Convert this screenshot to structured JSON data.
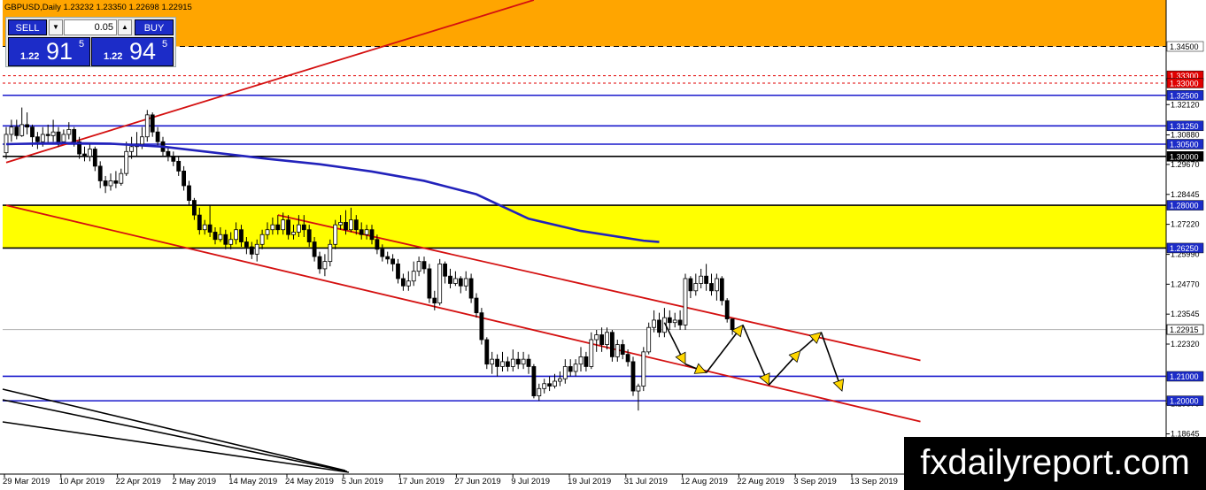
{
  "header": {
    "title": "GBPUSD,Daily  1.23232 1.23350 1.22698 1.22915"
  },
  "trade_panel": {
    "sell_label": "SELL",
    "buy_label": "BUY",
    "lot_value": "0.05",
    "sell_price_prefix": "1.22",
    "sell_price_main": "91",
    "sell_price_sup": "5",
    "buy_price_prefix": "1.22",
    "buy_price_main": "94",
    "buy_price_sup": "5",
    "lot_down_icon": "arrow-down-icon",
    "lot_up_icon": "arrow-up-icon"
  },
  "watermark": "fxdailyreport.com",
  "colors": {
    "orange_zone": "#ffa500",
    "yellow_zone": "#ffff00",
    "blue_line": "#1a1acc",
    "ma_line": "#2222bb",
    "red_line": "#d41010",
    "arrow_fill": "#ffd700",
    "tag_blue": "#1c2cc8",
    "tag_red": "#e00000"
  },
  "chart_data": {
    "type": "candlestick",
    "title": "GBPUSD,Daily",
    "ylim": [
      1.17,
      1.364
    ],
    "grid": false,
    "y_ticks": [
      "1.32120",
      "1.30880",
      "1.29670",
      "1.28445",
      "1.27220",
      "1.25990",
      "1.24770",
      "1.23545",
      "1.22320",
      "1.19870",
      "1.18645"
    ],
    "x_labels": [
      "29 Mar 2019",
      "10 Apr 2019",
      "22 Apr 2019",
      "2 May 2019",
      "14 May 2019",
      "24 May 2019",
      "5 Jun 2019",
      "17 Jun 2019",
      "27 Jun 2019",
      "9 Jul 2019",
      "19 Jul 2019",
      "31 Jul 2019",
      "12 Aug 2019",
      "22 Aug 2019",
      "3 Sep 2019",
      "13 Sep 2019"
    ],
    "horizontal_levels": [
      {
        "price": 1.345,
        "label": "1.34500",
        "color": "#000000",
        "style": "dashed",
        "tag": "white"
      },
      {
        "price": 1.333,
        "label": "1.33300",
        "color": "#e00000",
        "style": "dotted",
        "tag": "red"
      },
      {
        "price": 1.33,
        "label": "1.33000",
        "color": "#e00000",
        "style": "dotted",
        "tag": "red"
      },
      {
        "price": 1.325,
        "label": "1.32500",
        "color": "#1a1acc",
        "style": "solid",
        "tag": "blue"
      },
      {
        "price": 1.3125,
        "label": "1.31250",
        "color": "#1a1acc",
        "style": "solid",
        "tag": "blue"
      },
      {
        "price": 1.305,
        "label": "1.30500",
        "color": "#1a1acc",
        "style": "solid",
        "tag": "blue"
      },
      {
        "price": 1.3,
        "label": "1.30000",
        "color": "#000000",
        "style": "solid",
        "tag": "black"
      },
      {
        "price": 1.28,
        "label": "1.28000",
        "color": "#000000",
        "style": "solid",
        "tag": "blue"
      },
      {
        "price": 1.2625,
        "label": "1.26250",
        "color": "#000000",
        "style": "solid",
        "tag": "blue"
      },
      {
        "price": 1.21,
        "label": "1.21000",
        "color": "#1a1acc",
        "style": "solid",
        "tag": "blue"
      },
      {
        "price": 1.2,
        "label": "1.20000",
        "color": "#1a1acc",
        "style": "solid",
        "tag": "blue"
      }
    ],
    "current_price": {
      "price": 1.22915,
      "label": "1.22915"
    },
    "zones": [
      {
        "from": 1.345,
        "to": 1.364,
        "color": "orange"
      },
      {
        "from": 1.2625,
        "to": 1.28,
        "color": "yellow"
      }
    ],
    "trendlines": [
      {
        "from": [
          0,
          1.2975
        ],
        "to": [
          101,
          1.364
        ],
        "color": "red"
      },
      {
        "from": [
          0,
          1.28
        ],
        "to": [
          175,
          1.1915
        ],
        "color": "red"
      },
      {
        "from": [
          52,
          1.276
        ],
        "to": [
          175,
          1.2165
        ],
        "color": "red"
      }
    ],
    "moving_average": [
      [
        0,
        1.305
      ],
      [
        10,
        1.3055
      ],
      [
        20,
        1.3052
      ],
      [
        30,
        1.304
      ],
      [
        40,
        1.3015
      ],
      [
        50,
        1.299
      ],
      [
        60,
        1.2968
      ],
      [
        70,
        1.2938
      ],
      [
        80,
        1.29
      ],
      [
        90,
        1.2845
      ],
      [
        100,
        1.2745
      ],
      [
        110,
        1.2695
      ],
      [
        122,
        1.2655
      ],
      [
        125,
        1.265
      ]
    ],
    "projection_path": [
      [
        126,
        1.232
      ],
      [
        130,
        1.215
      ],
      [
        134,
        1.2115
      ],
      [
        141,
        1.231
      ],
      [
        146,
        1.2065
      ],
      [
        152,
        1.2205
      ],
      [
        156,
        1.228
      ],
      [
        160,
        1.204
      ]
    ],
    "candles": [
      [
        1.3015,
        1.309,
        1.312,
        1.299
      ],
      [
        1.309,
        1.312,
        1.315,
        1.306
      ],
      [
        1.312,
        1.3085,
        1.315,
        1.307
      ],
      [
        1.3085,
        1.313,
        1.32,
        1.308
      ],
      [
        1.313,
        1.312,
        1.318,
        1.309
      ],
      [
        1.312,
        1.308,
        1.313,
        1.304
      ],
      [
        1.308,
        1.306,
        1.31,
        1.303
      ],
      [
        1.306,
        1.309,
        1.312,
        1.304
      ],
      [
        1.309,
        1.3085,
        1.313,
        1.305
      ],
      [
        1.3085,
        1.31,
        1.315,
        1.306
      ],
      [
        1.31,
        1.306,
        1.312,
        1.304
      ],
      [
        1.306,
        1.309,
        1.311,
        1.305
      ],
      [
        1.309,
        1.311,
        1.314,
        1.307
      ],
      [
        1.311,
        1.306,
        1.312,
        1.304
      ],
      [
        1.306,
        1.301,
        1.308,
        1.299
      ],
      [
        1.301,
        1.3,
        1.304,
        1.298
      ],
      [
        1.3,
        1.303,
        1.305,
        1.298
      ],
      [
        1.303,
        1.296,
        1.304,
        1.294
      ],
      [
        1.296,
        1.29,
        1.298,
        1.287
      ],
      [
        1.29,
        1.288,
        1.292,
        1.285
      ],
      [
        1.288,
        1.29,
        1.293,
        1.286
      ],
      [
        1.29,
        1.289,
        1.294,
        1.287
      ],
      [
        1.289,
        1.293,
        1.295,
        1.288
      ],
      [
        1.293,
        1.302,
        1.306,
        1.292
      ],
      [
        1.302,
        1.304,
        1.308,
        1.299
      ],
      [
        1.304,
        1.305,
        1.31,
        1.3
      ],
      [
        1.305,
        1.308,
        1.312,
        1.303
      ],
      [
        1.308,
        1.317,
        1.319,
        1.306
      ],
      [
        1.317,
        1.31,
        1.318,
        1.308
      ],
      [
        1.31,
        1.306,
        1.312,
        1.304
      ],
      [
        1.306,
        1.302,
        1.308,
        1.3
      ],
      [
        1.302,
        1.3,
        1.304,
        1.298
      ],
      [
        1.3,
        1.298,
        1.302,
        1.296
      ],
      [
        1.298,
        1.294,
        1.3,
        1.292
      ],
      [
        1.294,
        1.288,
        1.296,
        1.286
      ],
      [
        1.288,
        1.282,
        1.29,
        1.28
      ],
      [
        1.282,
        1.276,
        1.283,
        1.274
      ],
      [
        1.276,
        1.27,
        1.279,
        1.268
      ],
      [
        1.27,
        1.272,
        1.274,
        1.268
      ],
      [
        1.272,
        1.269,
        1.28,
        1.267
      ],
      [
        1.269,
        1.266,
        1.271,
        1.264
      ],
      [
        1.266,
        1.268,
        1.271,
        1.265
      ],
      [
        1.268,
        1.264,
        1.27,
        1.262
      ],
      [
        1.264,
        1.266,
        1.269,
        1.262
      ],
      [
        1.266,
        1.27,
        1.273,
        1.264
      ],
      [
        1.27,
        1.265,
        1.272,
        1.263
      ],
      [
        1.265,
        1.263,
        1.267,
        1.26
      ],
      [
        1.263,
        1.26,
        1.265,
        1.258
      ],
      [
        1.26,
        1.264,
        1.266,
        1.257
      ],
      [
        1.264,
        1.268,
        1.27,
        1.262
      ],
      [
        1.268,
        1.27,
        1.273,
        1.266
      ],
      [
        1.27,
        1.272,
        1.275,
        1.268
      ],
      [
        1.272,
        1.27,
        1.276,
        1.268
      ],
      [
        1.27,
        1.274,
        1.277,
        1.268
      ],
      [
        1.274,
        1.268,
        1.276,
        1.266
      ],
      [
        1.268,
        1.269,
        1.272,
        1.266
      ],
      [
        1.269,
        1.272,
        1.276,
        1.267
      ],
      [
        1.272,
        1.27,
        1.276,
        1.267
      ],
      [
        1.27,
        1.265,
        1.272,
        1.263
      ],
      [
        1.265,
        1.259,
        1.267,
        1.257
      ],
      [
        1.259,
        1.254,
        1.261,
        1.252
      ],
      [
        1.254,
        1.257,
        1.26,
        1.251
      ],
      [
        1.257,
        1.264,
        1.266,
        1.255
      ],
      [
        1.264,
        1.272,
        1.274,
        1.262
      ],
      [
        1.272,
        1.273,
        1.276,
        1.27
      ],
      [
        1.273,
        1.27,
        1.278,
        1.268
      ],
      [
        1.27,
        1.274,
        1.279,
        1.269
      ],
      [
        1.274,
        1.27,
        1.276,
        1.268
      ],
      [
        1.27,
        1.268,
        1.273,
        1.266
      ],
      [
        1.268,
        1.27,
        1.272,
        1.266
      ],
      [
        1.27,
        1.266,
        1.272,
        1.264
      ],
      [
        1.266,
        1.262,
        1.268,
        1.26
      ],
      [
        1.262,
        1.259,
        1.264,
        1.257
      ],
      [
        1.259,
        1.258,
        1.261,
        1.256
      ],
      [
        1.258,
        1.256,
        1.26,
        1.253
      ],
      [
        1.256,
        1.25,
        1.258,
        1.248
      ],
      [
        1.25,
        1.247,
        1.252,
        1.245
      ],
      [
        1.247,
        1.249,
        1.253,
        1.245
      ],
      [
        1.249,
        1.253,
        1.257,
        1.247
      ],
      [
        1.253,
        1.257,
        1.259,
        1.251
      ],
      [
        1.257,
        1.254,
        1.259,
        1.252
      ],
      [
        1.254,
        1.242,
        1.256,
        1.24
      ],
      [
        1.242,
        1.24,
        1.245,
        1.237
      ],
      [
        1.24,
        1.256,
        1.258,
        1.239
      ],
      [
        1.256,
        1.251,
        1.257,
        1.248
      ],
      [
        1.251,
        1.248,
        1.254,
        1.246
      ],
      [
        1.248,
        1.25,
        1.253,
        1.247
      ],
      [
        1.25,
        1.247,
        1.251,
        1.244
      ],
      [
        1.247,
        1.25,
        1.253,
        1.245
      ],
      [
        1.25,
        1.242,
        1.252,
        1.24
      ],
      [
        1.242,
        1.236,
        1.244,
        1.234
      ],
      [
        1.236,
        1.225,
        1.238,
        1.223
      ],
      [
        1.225,
        1.215,
        1.226,
        1.213
      ],
      [
        1.215,
        1.217,
        1.22,
        1.211
      ],
      [
        1.217,
        1.214,
        1.219,
        1.21
      ],
      [
        1.214,
        1.216,
        1.22,
        1.212
      ],
      [
        1.216,
        1.214,
        1.218,
        1.212
      ],
      [
        1.214,
        1.217,
        1.221,
        1.212
      ],
      [
        1.217,
        1.215,
        1.22,
        1.213
      ],
      [
        1.215,
        1.217,
        1.22,
        1.213
      ],
      [
        1.217,
        1.214,
        1.219,
        1.211
      ],
      [
        1.214,
        1.202,
        1.215,
        1.201
      ],
      [
        1.202,
        1.205,
        1.207,
        1.2
      ],
      [
        1.205,
        1.207,
        1.209,
        1.203
      ],
      [
        1.207,
        1.206,
        1.21,
        1.204
      ],
      [
        1.206,
        1.208,
        1.211,
        1.205
      ],
      [
        1.208,
        1.209,
        1.212,
        1.206
      ],
      [
        1.209,
        1.214,
        1.217,
        1.207
      ],
      [
        1.214,
        1.212,
        1.217,
        1.21
      ],
      [
        1.212,
        1.215,
        1.217,
        1.21
      ],
      [
        1.215,
        1.218,
        1.222,
        1.212
      ],
      [
        1.218,
        1.214,
        1.22,
        1.212
      ],
      [
        1.214,
        1.225,
        1.228,
        1.213
      ],
      [
        1.225,
        1.227,
        1.229,
        1.22
      ],
      [
        1.227,
        1.223,
        1.23,
        1.22
      ],
      [
        1.223,
        1.228,
        1.23,
        1.221
      ],
      [
        1.228,
        1.218,
        1.229,
        1.216
      ],
      [
        1.218,
        1.223,
        1.225,
        1.216
      ],
      [
        1.223,
        1.219,
        1.225,
        1.217
      ],
      [
        1.219,
        1.216,
        1.221,
        1.214
      ],
      [
        1.216,
        1.204,
        1.218,
        1.202
      ],
      [
        1.204,
        1.206,
        1.207,
        1.196
      ],
      [
        1.206,
        1.22,
        1.222,
        1.204
      ],
      [
        1.22,
        1.23,
        1.232,
        1.219
      ],
      [
        1.23,
        1.233,
        1.237,
        1.228
      ],
      [
        1.233,
        1.228,
        1.236,
        1.226
      ],
      [
        1.228,
        1.234,
        1.238,
        1.226
      ],
      [
        1.234,
        1.232,
        1.237,
        1.229
      ],
      [
        1.232,
        1.233,
        1.236,
        1.23
      ],
      [
        1.233,
        1.231,
        1.237,
        1.229
      ],
      [
        1.231,
        1.25,
        1.252,
        1.229
      ],
      [
        1.25,
        1.245,
        1.251,
        1.242
      ],
      [
        1.245,
        1.248,
        1.252,
        1.243
      ],
      [
        1.248,
        1.251,
        1.254,
        1.246
      ],
      [
        1.251,
        1.248,
        1.256,
        1.245
      ],
      [
        1.248,
        1.245,
        1.252,
        1.243
      ],
      [
        1.245,
        1.25,
        1.252,
        1.241
      ],
      [
        1.25,
        1.241,
        1.251,
        1.239
      ],
      [
        1.241,
        1.2335,
        1.242,
        1.232
      ],
      [
        1.2335,
        1.22915,
        1.2335,
        1.22698
      ]
    ]
  }
}
